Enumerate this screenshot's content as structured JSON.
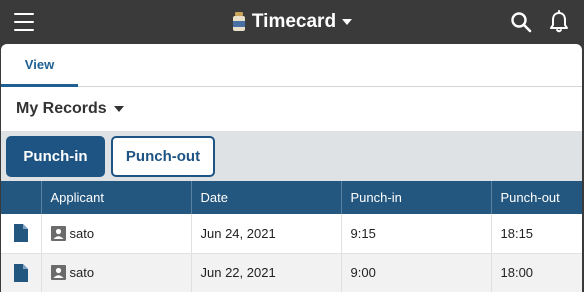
{
  "header": {
    "app_title": "Timecard",
    "icons": {
      "menu": "hamburger-menu-icon",
      "app": "timecard-bottle-icon",
      "search": "search-icon",
      "notifications": "bell-icon"
    }
  },
  "tabs": [
    {
      "label": "View",
      "active": true
    }
  ],
  "records_selector": {
    "label": "My Records"
  },
  "actions": {
    "punch_in_label": "Punch-in",
    "punch_out_label": "Punch-out"
  },
  "table": {
    "columns": [
      "",
      "Applicant",
      "Date",
      "Punch-in",
      "Punch-out"
    ],
    "rows": [
      {
        "applicant": "sato",
        "date": "Jun 24, 2021",
        "punch_in": "9:15",
        "punch_out": "18:15"
      },
      {
        "applicant": "sato",
        "date": "Jun 22, 2021",
        "punch_in": "9:00",
        "punch_out": "18:00"
      }
    ]
  },
  "colors": {
    "topbar": "#3a3a3a",
    "accent": "#1d5484",
    "header_row": "#24577f",
    "button_bar": "#dfe2e5"
  }
}
